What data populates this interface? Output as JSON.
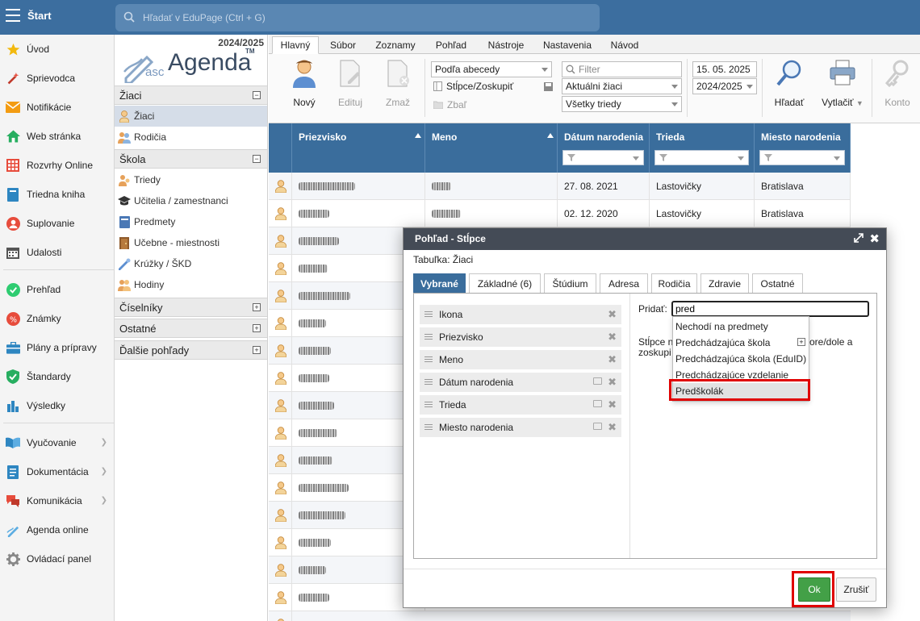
{
  "app": {
    "title": "Štart"
  },
  "search": {
    "placeholder": "Hľadať v EduPage (Ctrl + G)"
  },
  "nav": {
    "items": [
      {
        "label": "Úvod",
        "icon": "star-icon"
      },
      {
        "label": "Sprievodca",
        "icon": "magic-wand-icon"
      },
      {
        "label": "Notifikácie",
        "icon": "envelope-icon"
      },
      {
        "label": "Web stránka",
        "icon": "home-icon"
      },
      {
        "label": "Rozvrhy Online",
        "icon": "timetable-icon"
      },
      {
        "label": "Triedna kniha",
        "icon": "book-icon"
      },
      {
        "label": "Suplovanie",
        "icon": "person-swap-icon"
      },
      {
        "label": "Udalosti",
        "icon": "calendar-icon"
      },
      {
        "label": "Prehľad",
        "icon": "check-circle-icon"
      },
      {
        "label": "Známky",
        "icon": "grades-icon"
      },
      {
        "label": "Plány a prípravy",
        "icon": "briefcase-icon"
      },
      {
        "label": "Štandardy",
        "icon": "shield-check-icon"
      },
      {
        "label": "Výsledky",
        "icon": "bar-chart-icon"
      },
      {
        "label": "Vyučovanie",
        "icon": "open-book-icon"
      },
      {
        "label": "Dokumentácia",
        "icon": "document-icon"
      },
      {
        "label": "Komunikácia",
        "icon": "chat-icon"
      },
      {
        "label": "Agenda online",
        "icon": "pen-icon"
      },
      {
        "label": "Ovládací panel",
        "icon": "gear-icon"
      }
    ]
  },
  "sidebar": {
    "year": "2024/2025",
    "logo": {
      "prefix": "asc",
      "name": "Agenda",
      "tm": "TM"
    },
    "sections": {
      "ziaci": "Žiaci",
      "skola": "Škola",
      "ciselniky": "Číselníky",
      "ostatne": "Ostatné",
      "dalsie": "Ďalšie pohľady"
    },
    "items": {
      "ziaci": "Žiaci",
      "rodicia": "Rodičia",
      "triedy": "Triedy",
      "ucitelia": "Učitelia / zamestnanci",
      "predmety": "Predmety",
      "ucebne": "Učebne - miestnosti",
      "kruzky": "Krúžky / ŠKD",
      "hodiny": "Hodiny"
    }
  },
  "tabs": [
    "Hlavný",
    "Súbor",
    "Zoznamy",
    "Pohľad",
    "Nástroje",
    "Nastavenia",
    "Návod"
  ],
  "ribbon": {
    "novy": "Nový",
    "edituj": "Edituj",
    "zmaz": "Zmaž",
    "sort": "Podľa abecedy",
    "stlpce": "Stĺpce/Zoskupiť",
    "zbal": "Zbaľ",
    "filter_placeholder": "Filter",
    "students_filter": "Aktuálni žiaci",
    "class_filter": "Všetky triedy",
    "date": "15. 05. 2025",
    "year": "2024/2025",
    "hladat": "Hľadať",
    "vytlacit": "Vytlačiť",
    "konto": "Konto"
  },
  "grid": {
    "headers": [
      "Priezvisko",
      "Meno",
      "Dátum narodenia",
      "Trieda",
      "Miesto narodenia"
    ],
    "rows": [
      {
        "datum": "27. 08. 2021",
        "trieda": "Lastovičky",
        "miesto": "Bratislava"
      },
      {
        "datum": "02. 12. 2020",
        "trieda": "Lastovičky",
        "miesto": "Bratislava"
      }
    ]
  },
  "dialog": {
    "title": "Pohľad - Stĺpce",
    "table_label": "Tabuľka: Žiaci",
    "tabs": [
      "Vybrané",
      "Základné (6)",
      "Štúdium",
      "Adresa",
      "Rodičia",
      "Zdravie",
      "Ostatné"
    ],
    "selected_columns": [
      "Ikona",
      "Priezvisko",
      "Meno",
      "Dátum narodenia",
      "Trieda",
      "Miesto narodenia"
    ],
    "add_label": "Pridať:",
    "add_value": "pred",
    "hint_left": "Stĺpce n",
    "hint_left2": "zoskupi",
    "hint_right": "ore/dole a",
    "suggestions": [
      "Nechodí na predmety",
      "Predchádzajúca škola",
      "Predchádzajúca škola (EduID)",
      "Predchádzajúce vzdelanie",
      "Predškolák"
    ],
    "ok": "Ok",
    "cancel": "Zrušiť"
  },
  "colors": {
    "topbar": "#3c6e9f",
    "grid_header": "#3a6d9c",
    "dialog_header": "#444b56",
    "ok_button": "#43a047",
    "highlight": "#e00000"
  }
}
